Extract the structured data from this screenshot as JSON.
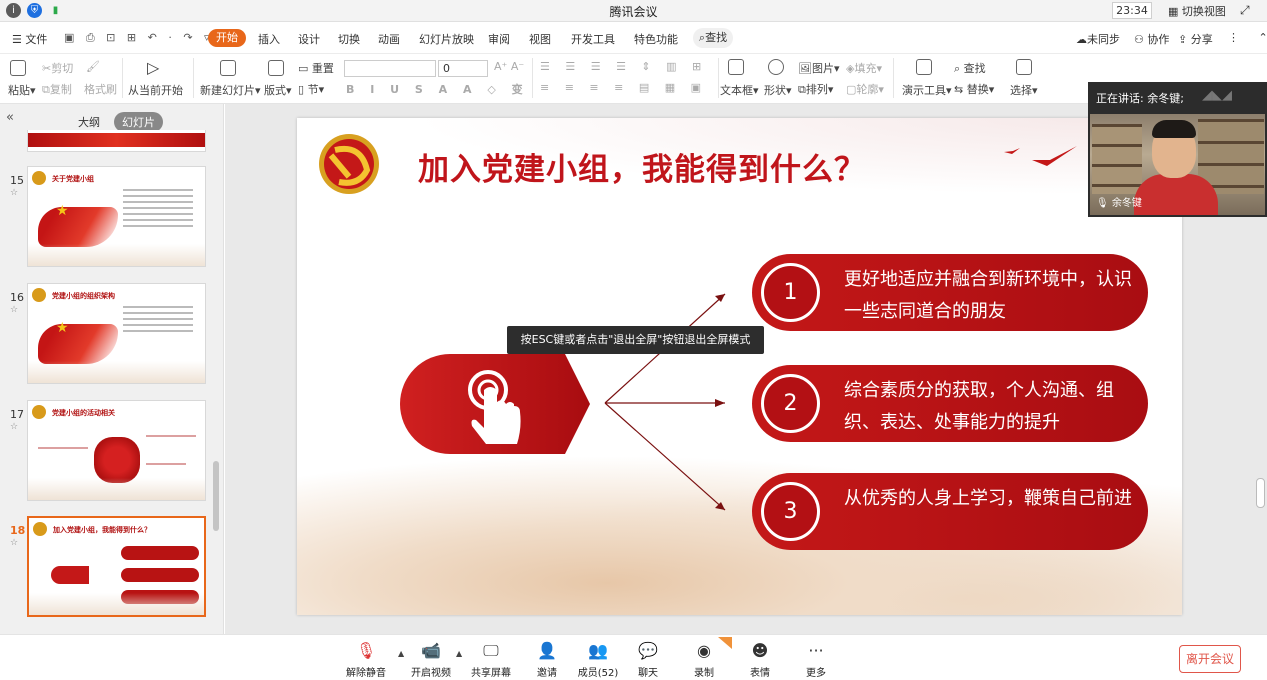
{
  "window": {
    "title": "腾讯会议",
    "clock": "23:34",
    "switch_view": "切换视图"
  },
  "menu": {
    "file": "文件",
    "start": "开始",
    "insert": "插入",
    "design": "设计",
    "transition": "切换",
    "animation": "动画",
    "slideshow": "幻灯片放映",
    "review": "审阅",
    "view": "视图",
    "devtools": "开发工具",
    "features": "特色功能",
    "search": "查找",
    "unsynced": "未同步",
    "collab": "协作",
    "share": "分享"
  },
  "ribbon": {
    "paste": "粘贴",
    "cut": "剪切",
    "copy": "复制",
    "format_painter": "格式刷",
    "from_current": "从当前开始",
    "new_slide": "新建幻灯片",
    "layout": "版式",
    "reset": "重置",
    "section": "节",
    "font_size": "0",
    "textbox": "文本框",
    "shape": "形状",
    "picture": "图片",
    "arrange": "排列",
    "fill": "填充",
    "outline": "轮廓",
    "presenter_tools": "演示工具",
    "find": "查找",
    "replace": "替换",
    "select": "选择"
  },
  "leftpanel": {
    "tab_outline": "大纲",
    "tab_slides": "幻灯片",
    "slides": [
      {
        "num": "15",
        "title": "关于党建小组"
      },
      {
        "num": "16",
        "title": "党建小组的组织架构"
      },
      {
        "num": "17",
        "title": "党建小组的活动相关"
      },
      {
        "num": "18",
        "title": "加入党建小组，我能得到什么？"
      }
    ]
  },
  "slide": {
    "title": "加入党建小组，我能得到什么？",
    "items": [
      {
        "num": "1",
        "text": "更好地适应并融合到新环境中，认识一些志同道合的朋友"
      },
      {
        "num": "2",
        "text": "综合素质分的获取，个人沟通、组织、表达、处事能力的提升"
      },
      {
        "num": "3",
        "text": "从优秀的人身上学习，鞭策自己前进"
      }
    ]
  },
  "tooltip": "按ESC键或者点击\"退出全屏\"按钮退出全屏模式",
  "video": {
    "speaking_label": "正在讲话: 余冬键;",
    "participant_name": "余冬键"
  },
  "bottombar": {
    "unmute": "解除静音",
    "start_video": "开启视频",
    "share_screen": "共享屏幕",
    "invite": "邀请",
    "members": "成员(52)",
    "chat": "聊天",
    "record": "录制",
    "reactions": "表情",
    "more": "更多",
    "leave": "离开会议"
  },
  "colors": {
    "accent_orange": "#e8671a",
    "party_red": "#c0151b",
    "leave_red": "#e0564a"
  }
}
